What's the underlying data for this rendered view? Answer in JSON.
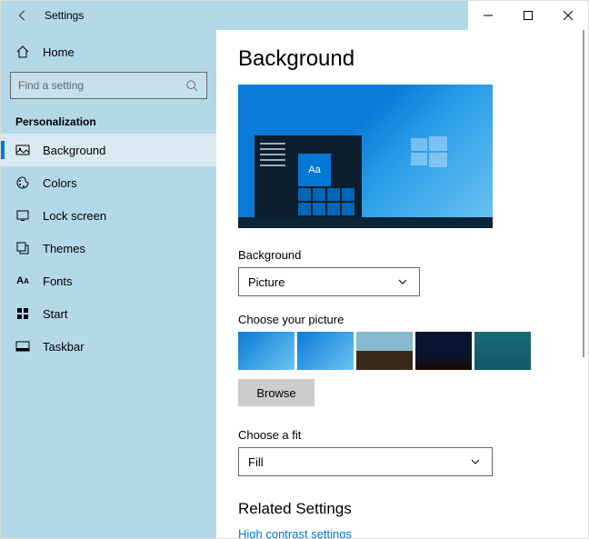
{
  "window": {
    "title": "Settings"
  },
  "sidebar": {
    "home": "Home",
    "search_placeholder": "Find a setting",
    "category": "Personalization",
    "items": [
      {
        "label": "Background",
        "active": true
      },
      {
        "label": "Colors"
      },
      {
        "label": "Lock screen"
      },
      {
        "label": "Themes"
      },
      {
        "label": "Fonts"
      },
      {
        "label": "Start"
      },
      {
        "label": "Taskbar"
      }
    ]
  },
  "main": {
    "heading": "Background",
    "preview_tile_text": "Aa",
    "bg_label": "Background",
    "bg_value": "Picture",
    "choose_label": "Choose your picture",
    "browse": "Browse",
    "fit_label": "Choose a fit",
    "fit_value": "Fill",
    "related_heading": "Related Settings",
    "related_link": "High contrast settings"
  }
}
